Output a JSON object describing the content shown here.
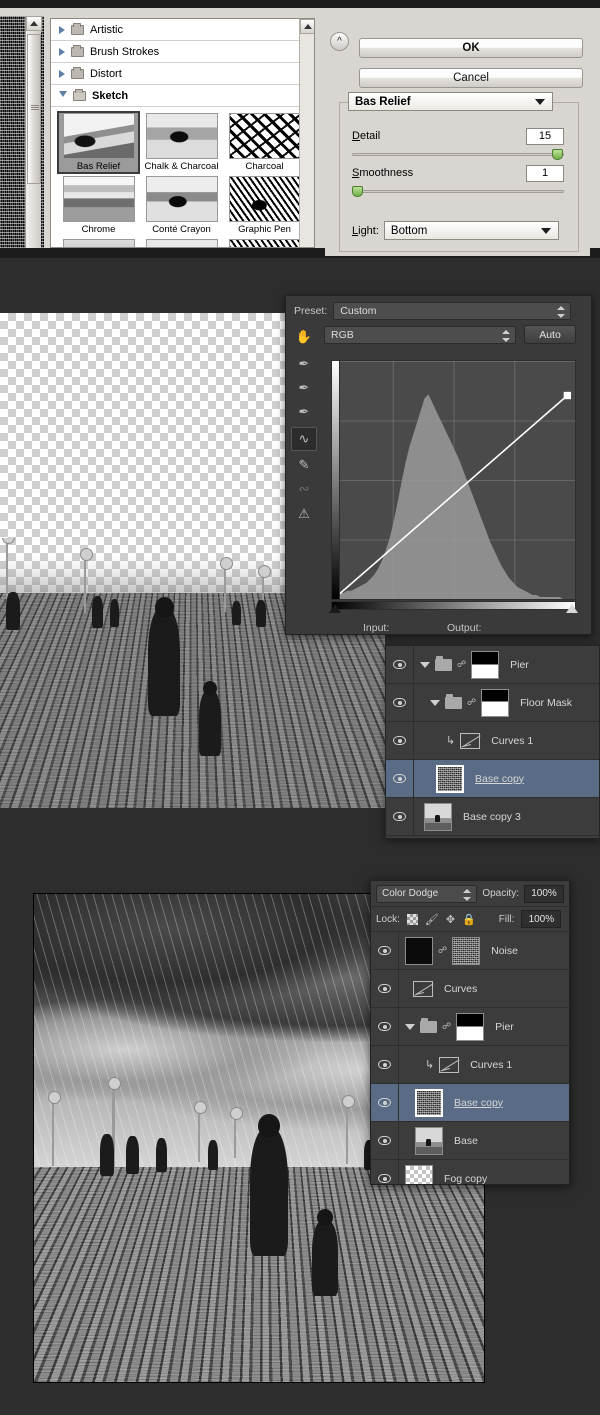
{
  "app": "Adobe Photoshop",
  "filter_gallery": {
    "categories": [
      {
        "label": "Artistic",
        "expanded": false
      },
      {
        "label": "Brush Strokes",
        "expanded": false
      },
      {
        "label": "Distort",
        "expanded": false
      },
      {
        "label": "Sketch",
        "expanded": true
      }
    ],
    "thumbnails": [
      {
        "label": "Bas Relief",
        "selected": true
      },
      {
        "label": "Chalk & Charcoal",
        "selected": false
      },
      {
        "label": "Charcoal",
        "selected": false
      },
      {
        "label": "Chrome",
        "selected": false
      },
      {
        "label": "Conté Crayon",
        "selected": false
      },
      {
        "label": "Graphic Pen",
        "selected": false
      }
    ],
    "buttons": {
      "ok": "OK",
      "cancel": "Cancel",
      "collapse_icon": "chevron-double-up-icon"
    },
    "active_filter": "Bas Relief",
    "params": [
      {
        "label": "Detail",
        "accesskey": "D",
        "value": "15",
        "slider_pct": 100
      },
      {
        "label": "Smoothness",
        "accesskey": "S",
        "value": "1",
        "slider_pct": 0
      }
    ],
    "light": {
      "label": "Light:",
      "value": "Bottom"
    }
  },
  "curves": {
    "preset_label": "Preset:",
    "preset_value": "Custom",
    "channel_value": "RGB",
    "auto_label": "Auto",
    "input_label": "Input:",
    "output_label": "Output:",
    "tools": [
      {
        "name": "adjust-on-image-icon",
        "active": false,
        "dim": false
      },
      {
        "name": "eyedropper-black-point-icon",
        "active": false,
        "dim": false
      },
      {
        "name": "eyedropper-gray-point-icon",
        "active": false,
        "dim": false
      },
      {
        "name": "eyedropper-white-point-icon",
        "active": false,
        "dim": false
      },
      {
        "name": "curve-point-tool-icon",
        "active": true,
        "dim": false
      },
      {
        "name": "pencil-draw-curve-icon",
        "active": false,
        "dim": false
      },
      {
        "name": "smooth-curve-icon",
        "active": false,
        "dim": true
      },
      {
        "name": "clipping-warning-icon",
        "active": false,
        "dim": false
      }
    ],
    "chart_data": {
      "type": "line",
      "title": "RGB Curve",
      "xlabel": "Input",
      "ylabel": "Output",
      "xlim": [
        0,
        255
      ],
      "ylim": [
        0,
        255
      ],
      "grid": true,
      "curve_points": [
        {
          "input": 4,
          "output": 2
        },
        {
          "input": 247,
          "output": 218
        }
      ],
      "histogram_bins": [
        2,
        2,
        3,
        3,
        4,
        4,
        5,
        6,
        7,
        8,
        10,
        12,
        15,
        19,
        24,
        30,
        38,
        47,
        57,
        66,
        74,
        80,
        86,
        92,
        98,
        100,
        96,
        92,
        88,
        84,
        80,
        76,
        72,
        68,
        63,
        58,
        53,
        48,
        43,
        38,
        33,
        28,
        24,
        20,
        16,
        13,
        10,
        8,
        6,
        5,
        4,
        3,
        2,
        2,
        1,
        1,
        1,
        1,
        1,
        1,
        0,
        0,
        0,
        0
      ],
      "black_point": 4,
      "white_point": 247
    }
  },
  "layers_panel_a": {
    "rows": [
      {
        "name": "Pier",
        "visible": true,
        "type": "group",
        "expanded": true,
        "linked": true,
        "mask": "pier-mask",
        "selected": false,
        "indent": 0
      },
      {
        "name": "Floor Mask",
        "visible": true,
        "type": "group",
        "expanded": true,
        "linked": true,
        "mask": "floor-mask",
        "selected": false,
        "indent": 1
      },
      {
        "name": "Curves 1",
        "visible": true,
        "type": "adjustment",
        "clipped": true,
        "selected": false,
        "indent": 2
      },
      {
        "name": "Base copy",
        "visible": true,
        "type": "pixel",
        "thumb": "noise",
        "selected": true,
        "indent": 2
      },
      {
        "name": "Base copy 3",
        "visible": true,
        "type": "pixel",
        "thumb": "photo",
        "selected": false,
        "indent": 1
      }
    ]
  },
  "layers_panel_b": {
    "blend_mode": "Color Dodge",
    "opacity_label": "Opacity:",
    "opacity_value": "100%",
    "lock_label": "Lock:",
    "fill_label": "Fill:",
    "fill_value": "100%",
    "lock_icons": [
      "lock-transparent-pixels-icon",
      "lock-image-pixels-icon",
      "lock-position-icon",
      "lock-all-icon"
    ],
    "rows": [
      {
        "name": "Noise",
        "visible": true,
        "type": "pixel",
        "thumb": "noiseblack",
        "mask": "noise",
        "linked": true,
        "selected": false,
        "indent": 0
      },
      {
        "name": "Curves",
        "visible": true,
        "type": "adjustment",
        "clipped": false,
        "selected": false,
        "indent": 0
      },
      {
        "name": "Pier",
        "visible": true,
        "type": "group",
        "expanded": true,
        "linked": true,
        "mask": "pier-mask",
        "selected": false,
        "indent": 0
      },
      {
        "name": "Curves 1",
        "visible": true,
        "type": "adjustment",
        "clipped": true,
        "selected": false,
        "indent": 1
      },
      {
        "name": "Base copy",
        "visible": true,
        "type": "pixel",
        "thumb": "noise",
        "selected": true,
        "indent": 1
      },
      {
        "name": "Base",
        "visible": true,
        "type": "pixel",
        "thumb": "photo",
        "selected": false,
        "indent": 1
      },
      {
        "name": "Fog copy",
        "visible": true,
        "type": "pixel",
        "thumb": "checker",
        "selected": false,
        "indent": 0
      }
    ]
  },
  "colors": {
    "panel_bg": "#3c3c3c",
    "dialog_bg": "#d9d6d2",
    "selection_blue": "#5a6b85",
    "slider_green": "#6fae45",
    "backdrop": "#2d2d2d"
  }
}
